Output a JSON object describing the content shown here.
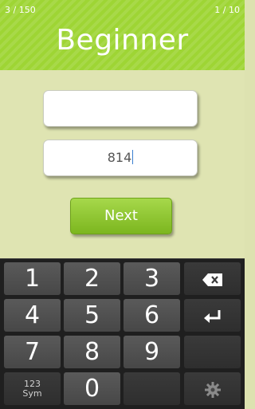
{
  "header": {
    "progress_left": "3 / 150",
    "progress_right": "1 / 10",
    "title": "Beginner"
  },
  "form": {
    "question_value": "",
    "answer_value": "814",
    "next_label": "Next"
  },
  "keyboard": {
    "keys": {
      "k1": "1",
      "k2": "2",
      "k3": "3",
      "k4": "4",
      "k5": "5",
      "k6": "6",
      "k7": "7",
      "k8": "8",
      "k9": "9",
      "k0": "0",
      "sym_top": "123",
      "sym_bottom": "Sym"
    },
    "icons": {
      "backspace": "backspace-icon",
      "enter": "enter-icon",
      "settings": "gear-icon"
    }
  },
  "colors": {
    "header": "#9ed534",
    "content_bg": "#dfe4b2",
    "button": "#8cc63f",
    "keyboard_bg": "#1f1f1f"
  }
}
